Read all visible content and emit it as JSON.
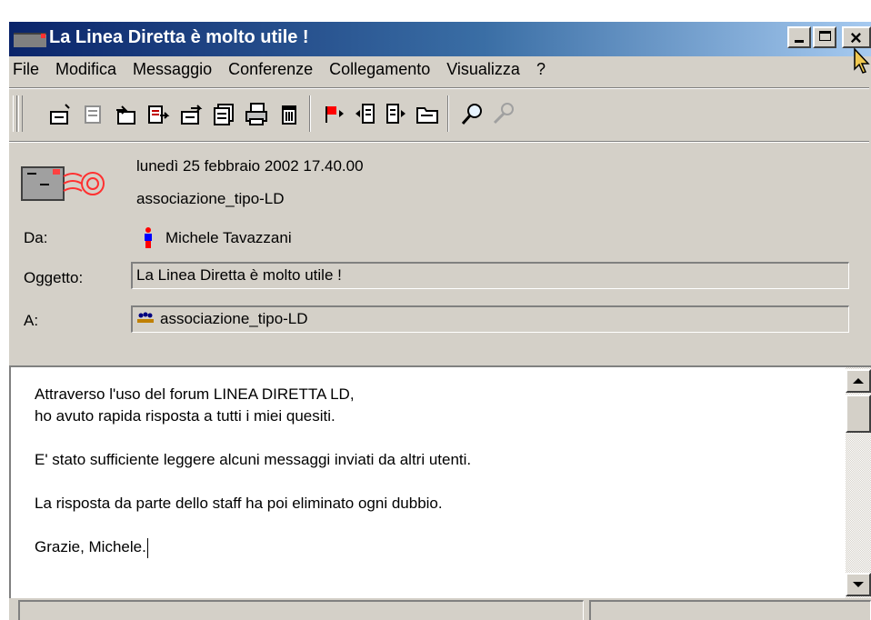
{
  "window": {
    "title": "La Linea Diretta è molto utile !"
  },
  "menu": {
    "items": [
      "File",
      "Modifica",
      "Messaggio",
      "Conferenze",
      "Collegamento",
      "Visualizza",
      "?"
    ]
  },
  "toolbar": {
    "icons": [
      "new-message-icon",
      "reply-icon",
      "reply-all-icon",
      "forward-icon",
      "forward-as-attachment-icon",
      "copy-icon",
      "print-icon",
      "delete-icon",
      "flag-icon",
      "previous-message-icon",
      "next-message-icon",
      "open-folder-icon",
      "find-icon",
      "tools-icon"
    ]
  },
  "header": {
    "date": "lunedì 25 febbraio 2002 17.40.00",
    "group": "associazione_tipo-LD",
    "from_label": "Da:",
    "from_value": "Michele Tavazzani",
    "subject_label": "Oggetto:",
    "subject_value": "La Linea Diretta è molto utile !",
    "to_label": "A:",
    "to_value": "associazione_tipo-LD"
  },
  "body": {
    "lines": [
      "Attraverso l'uso del forum LINEA DIRETTA LD,",
      "ho avuto rapida risposta a tutti i miei quesiti.",
      "",
      "E' stato sufficiente leggere alcuni messaggi inviati da altri utenti.",
      "",
      "La risposta da parte dello staff ha poi eliminato ogni dubbio.",
      "",
      "Grazie, Michele."
    ]
  },
  "colors": {
    "titlebar_start": "#0a246a",
    "titlebar_end": "#a6caf0",
    "face": "#d4d0c8",
    "flag_red": "#ff0000"
  }
}
